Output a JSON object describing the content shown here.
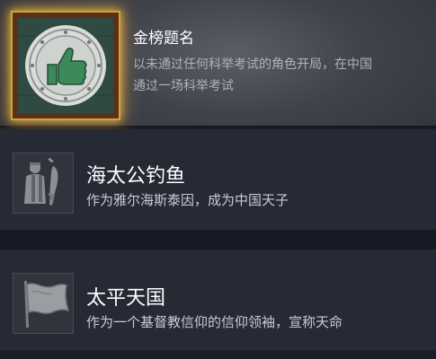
{
  "achievements": [
    {
      "title": "金榜题名",
      "description_line1": "以未通过任何科举考试的角色开局，在中国",
      "description_line2": "通过一场科举考试",
      "icon": "thumbs-up-medal-icon",
      "highlighted": true
    },
    {
      "title": "海太公钓鱼",
      "description": "作为雅尔海斯泰因，成为中国天子",
      "icon": "fisherman-icon"
    },
    {
      "title": "太平天国",
      "description": "作为一个基督教信仰的信仰领袖，宣称天命",
      "icon": "flag-icon"
    }
  ],
  "colors": {
    "glow": "#f2b23a",
    "medal_green": "#2f4a40",
    "frame_brown": "#5a3016"
  }
}
